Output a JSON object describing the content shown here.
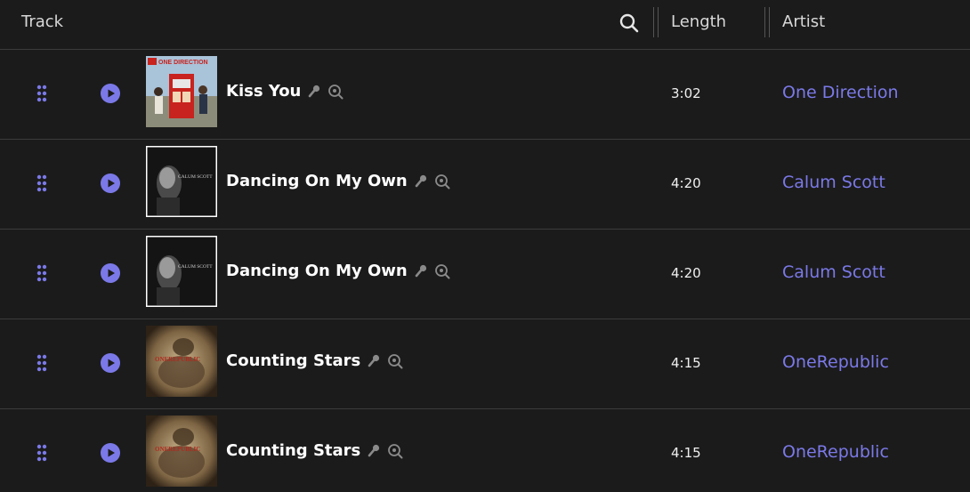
{
  "header": {
    "track_label": "Track",
    "length_label": "Length",
    "artist_label": "Artist"
  },
  "colors": {
    "background": "#1b1b1b",
    "accent": "#7b79e8",
    "divider": "#3c3c3c"
  },
  "rows": [
    {
      "title": "Kiss You",
      "length": "3:02",
      "artist": "One Direction",
      "cover_text": "ONE DIRECTION",
      "cover": "red-phone-booth"
    },
    {
      "title": "Dancing On My Own",
      "length": "4:20",
      "artist": "Calum Scott",
      "cover_text": "CALUM SCOTT",
      "cover": "dark-portrait"
    },
    {
      "title": "Dancing On My Own",
      "length": "4:20",
      "artist": "Calum Scott",
      "cover_text": "CALUM SCOTT",
      "cover": "dark-portrait"
    },
    {
      "title": "Counting Stars",
      "length": "4:15",
      "artist": "OneRepublic",
      "cover_text": "ONEREPUBLIC",
      "cover": "sepia-art"
    },
    {
      "title": "Counting Stars",
      "length": "4:15",
      "artist": "OneRepublic",
      "cover_text": "ONEREPUBLIC",
      "cover": "sepia-art"
    }
  ],
  "icons": {
    "drag": "drag-handle-icon",
    "play": "play-icon",
    "search": "search-icon",
    "microphone": "microphone-icon",
    "lyrics_search": "lyrics-search-icon"
  }
}
